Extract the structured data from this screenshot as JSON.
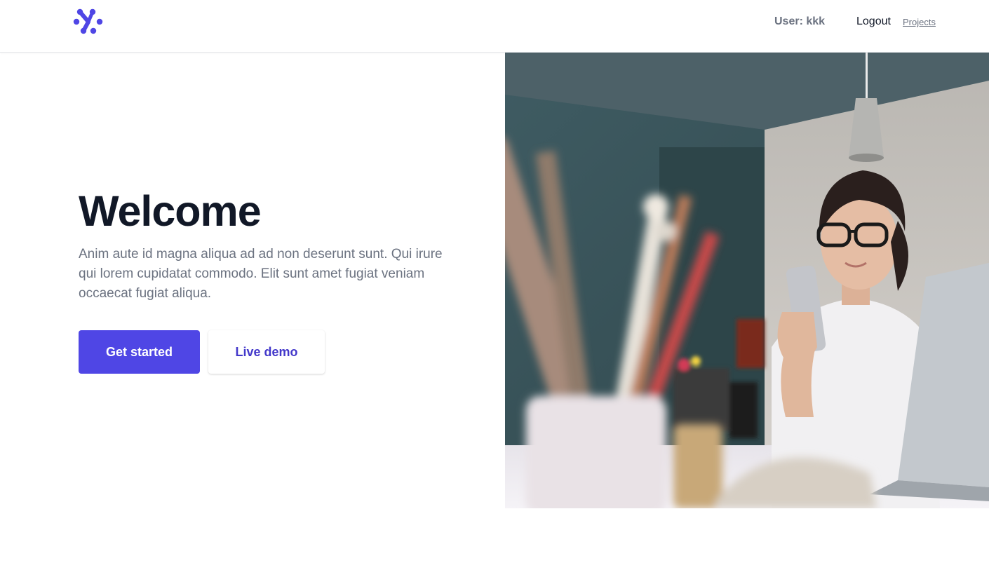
{
  "header": {
    "logo_icon": "brand-logo-icon",
    "user_label": "User: kkk",
    "logout_label": "Logout",
    "projects_label": "Projects"
  },
  "hero": {
    "title": "Welcome",
    "description": "Anim aute id magna aliqua ad ad non deserunt sunt. Qui irure qui lorem cupidatat commodo. Elit sunt amet fugiat veniam occaecat fugiat aliqua.",
    "primary_button_label": "Get started",
    "secondary_button_label": "Live demo",
    "image_subject": "woman with glasses using a phone at an art desk"
  },
  "colors": {
    "accent": "#4f46e5",
    "accent_text": "#4338ca",
    "heading": "#111827",
    "body_text": "#6b7280"
  }
}
